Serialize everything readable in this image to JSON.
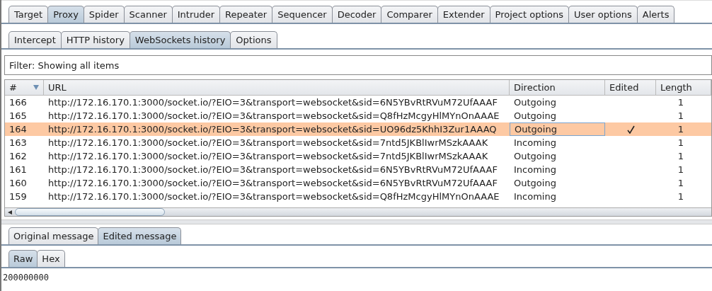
{
  "main_tabs": [
    {
      "label": "Target",
      "selected": false
    },
    {
      "label": "Proxy",
      "selected": true
    },
    {
      "label": "Spider",
      "selected": false
    },
    {
      "label": "Scanner",
      "selected": false
    },
    {
      "label": "Intruder",
      "selected": false
    },
    {
      "label": "Repeater",
      "selected": false
    },
    {
      "label": "Sequencer",
      "selected": false
    },
    {
      "label": "Decoder",
      "selected": false
    },
    {
      "label": "Comparer",
      "selected": false
    },
    {
      "label": "Extender",
      "selected": false
    },
    {
      "label": "Project options",
      "selected": false
    },
    {
      "label": "User options",
      "selected": false
    },
    {
      "label": "Alerts",
      "selected": false
    }
  ],
  "sub_tabs": [
    {
      "label": "Intercept",
      "selected": false
    },
    {
      "label": "HTTP history",
      "selected": false
    },
    {
      "label": "WebSockets history",
      "selected": true
    },
    {
      "label": "Options",
      "selected": false
    }
  ],
  "filter": "Filter: Showing all items",
  "table": {
    "columns": [
      "#",
      "URL",
      "Direction",
      "Edited",
      "Length"
    ],
    "rows": [
      {
        "num": "166",
        "url": "http://172.16.170.1:3000/socket.io/?EIO=3&transport=websocket&sid=6N5YBvRtRVuM72UfAAAF",
        "direction": "Outgoing",
        "edited": false,
        "length": "1",
        "selected": false
      },
      {
        "num": "165",
        "url": "http://172.16.170.1:3000/socket.io/?EIO=3&transport=websocket&sid=Q8fHzMcgyHlMYnOnAAAE",
        "direction": "Outgoing",
        "edited": false,
        "length": "1",
        "selected": false
      },
      {
        "num": "164",
        "url": "http://172.16.170.1:3000/socket.io/?EIO=3&transport=websocket&sid=UO96dz5KhhI3Zur1AAAQ",
        "direction": "Outgoing",
        "edited": true,
        "length": "1",
        "selected": true
      },
      {
        "num": "163",
        "url": "http://172.16.170.1:3000/socket.io/?EIO=3&transport=websocket&sid=7ntd5JKBlIwrMSzkAAAK",
        "direction": "Incoming",
        "edited": false,
        "length": "1",
        "selected": false
      },
      {
        "num": "162",
        "url": "http://172.16.170.1:3000/socket.io/?EIO=3&transport=websocket&sid=7ntd5JKBlIwrMSzkAAAK",
        "direction": "Outgoing",
        "edited": false,
        "length": "1",
        "selected": false
      },
      {
        "num": "161",
        "url": "http://172.16.170.1:3000/socket.io/?EIO=3&transport=websocket&sid=6N5YBvRtRVuM72UfAAAF",
        "direction": "Incoming",
        "edited": false,
        "length": "1",
        "selected": false
      },
      {
        "num": "160",
        "url": "http://172.16.170.1:3000/socket.io/?EIO=3&transport=websocket&sid=6N5YBvRtRVuM72UfAAAF",
        "direction": "Outgoing",
        "edited": false,
        "length": "1",
        "selected": false
      },
      {
        "num": "159",
        "url": "http://172.16.170.1:3000/socket.io/?EIO=3&transport=websocket&sid=Q8fHzMcgyHlMYnOnAAAE",
        "direction": "Incoming",
        "edited": false,
        "length": "1",
        "selected": false
      }
    ]
  },
  "message_tabs": [
    {
      "label": "Original message",
      "selected": false
    },
    {
      "label": "Edited message",
      "selected": true
    }
  ],
  "view_tabs": [
    {
      "label": "Raw",
      "selected": true
    },
    {
      "label": "Hex",
      "selected": false
    }
  ],
  "message_body": "200000000"
}
